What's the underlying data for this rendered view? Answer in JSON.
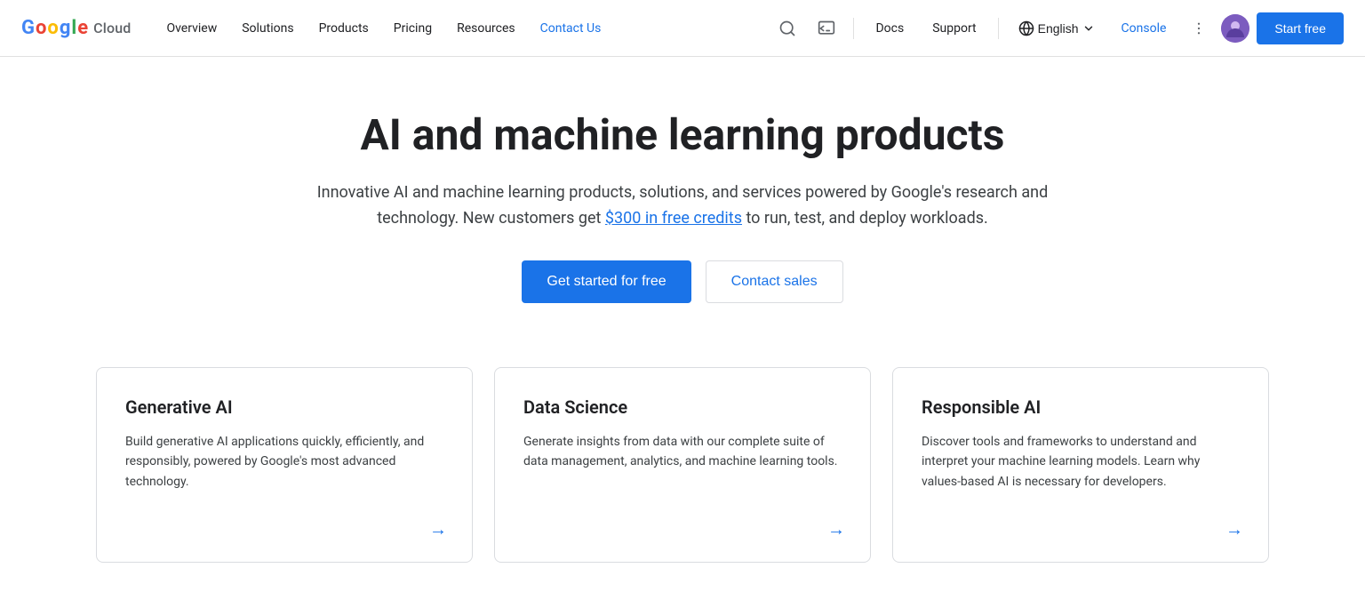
{
  "nav": {
    "brand": "Cloud",
    "links": [
      {
        "id": "overview",
        "label": "Overview"
      },
      {
        "id": "solutions",
        "label": "Solutions"
      },
      {
        "id": "products",
        "label": "Products"
      },
      {
        "id": "pricing",
        "label": "Pricing"
      },
      {
        "id": "resources",
        "label": "Resources"
      },
      {
        "id": "contact-us",
        "label": "Contact Us",
        "active": true
      }
    ],
    "docs_label": "Docs",
    "support_label": "Support",
    "language": "English",
    "console_label": "Console",
    "start_free_label": "Start free"
  },
  "hero": {
    "title": "AI and machine learning products",
    "subtitle_before": "Innovative AI and machine learning products, solutions, and services powered by Google's research and technology. New customers get ",
    "credits_link_text": "$300 in free credits",
    "subtitle_after": " to run, test, and deploy workloads.",
    "cta_primary": "Get started for free",
    "cta_secondary": "Contact sales"
  },
  "cards": [
    {
      "id": "generative-ai",
      "title": "Generative AI",
      "description": "Build generative AI applications quickly, efficiently, and responsibly, powered by Google's most advanced technology."
    },
    {
      "id": "data-science",
      "title": "Data Science",
      "description": "Generate insights from data with our complete suite of data management, analytics, and machine learning tools."
    },
    {
      "id": "responsible-ai",
      "title": "Responsible AI",
      "description": "Discover tools and frameworks to understand and interpret your machine learning models. Learn why values-based AI is necessary for developers."
    }
  ]
}
